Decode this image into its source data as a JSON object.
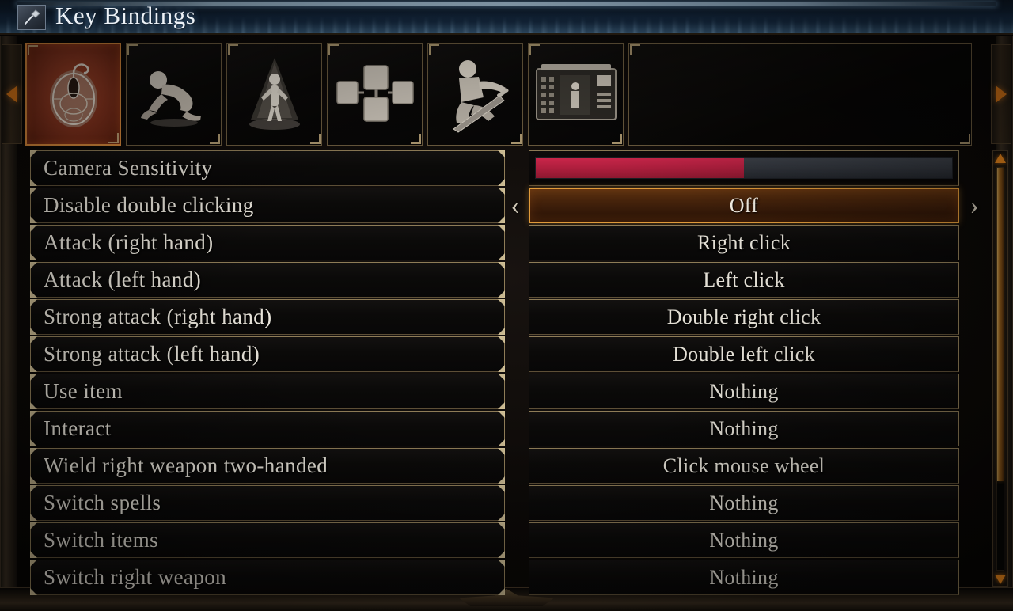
{
  "window": {
    "title": "Key Bindings",
    "title_icon": "hammer-icon"
  },
  "tabs": {
    "prev_arrow_icon": "arrow-left-icon",
    "next_arrow_icon": "arrow-right-icon",
    "selected_index": 0,
    "items": [
      {
        "icon": "mouse-controls-icon",
        "label": "Mouse"
      },
      {
        "icon": "crawling-figure-icon",
        "label": "Movement"
      },
      {
        "icon": "figure-in-light-icon",
        "label": "Character"
      },
      {
        "icon": "inventory-grid-icon",
        "label": "Items"
      },
      {
        "icon": "kneeling-knight-icon",
        "label": "Gestures"
      },
      {
        "icon": "hud-screen-icon",
        "label": "Display"
      }
    ]
  },
  "bindings": {
    "rows": [
      {
        "label": "Camera Sensitivity",
        "type": "slider",
        "value_percent": 50
      },
      {
        "label": "Disable double clicking",
        "type": "option",
        "value": "Off",
        "selected": true
      },
      {
        "label": "Attack (right hand)",
        "type": "option",
        "value": "Right click"
      },
      {
        "label": "Attack (left hand)",
        "type": "option",
        "value": "Left click"
      },
      {
        "label": "Strong attack (right hand)",
        "type": "option",
        "value": "Double right click"
      },
      {
        "label": "Strong attack (left hand)",
        "type": "option",
        "value": "Double left click"
      },
      {
        "label": "Use item",
        "type": "option",
        "value": "Nothing"
      },
      {
        "label": "Interact",
        "type": "option",
        "value": "Nothing"
      },
      {
        "label": "Wield right weapon two-handed",
        "type": "option",
        "value": "Click mouse wheel"
      },
      {
        "label": "Switch spells",
        "type": "option",
        "value": "Nothing"
      },
      {
        "label": "Switch items",
        "type": "option",
        "value": "Nothing"
      },
      {
        "label": "Switch right weapon",
        "type": "option",
        "value": "Nothing"
      }
    ],
    "prev_value_chevron": "‹",
    "next_value_chevron": "›"
  },
  "scrollbar": {
    "up_arrow_icon": "scroll-up-icon",
    "down_arrow_icon": "scroll-down-icon",
    "thumb_top_percent": 0,
    "thumb_size_percent": 78
  },
  "colors": {
    "accent_orange": "#e09a3a",
    "slider_red": "#c9264a",
    "slider_track": "#32363d",
    "selected_tab_red": "#8a3620",
    "border_gold": "#8e7c57",
    "title_blue": "#11243a"
  }
}
